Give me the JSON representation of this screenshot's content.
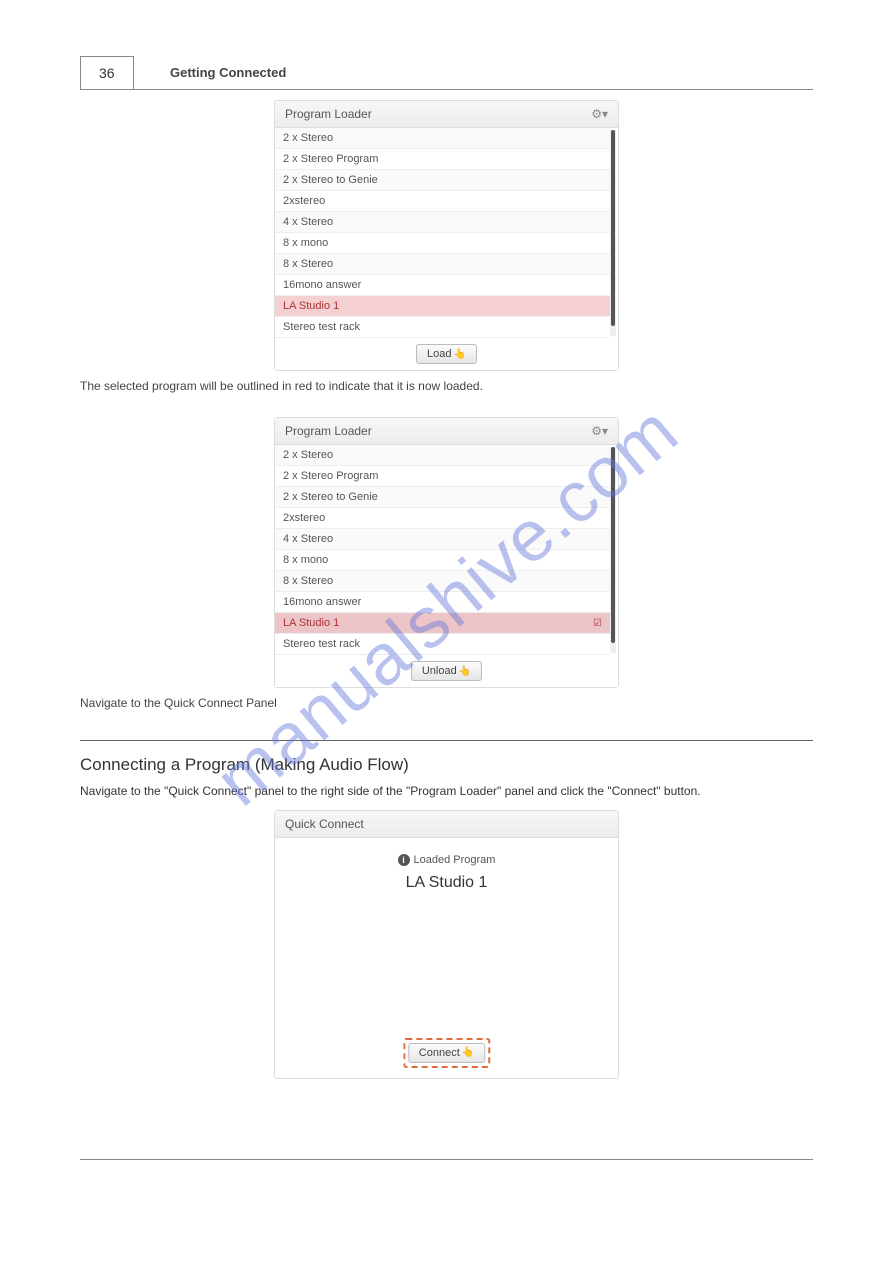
{
  "page": {
    "number": "36",
    "header_title": "Getting Connected",
    "footer_left": "",
    "footer_right": ""
  },
  "watermark": "manualshive.com",
  "panel1": {
    "title": "Program Loader",
    "items": [
      "2 x Stereo",
      "2 x Stereo Program",
      "2 x Stereo to Genie",
      "2xstereo",
      "4 x Stereo",
      "8 x mono",
      "8 x Stereo",
      "16mono answer",
      "LA Studio 1",
      "Stereo test rack"
    ],
    "selected_index": 8,
    "button": "Load"
  },
  "caption1": "The selected program will be outlined in red to indicate that it is now loaded.",
  "panel2": {
    "title": "Program Loader",
    "items": [
      "2 x Stereo",
      "2 x Stereo Program",
      "2 x Stereo to Genie",
      "2xstereo",
      "4 x Stereo",
      "8 x mono",
      "8 x Stereo",
      "16mono answer",
      "LA Studio 1",
      "Stereo test rack"
    ],
    "selected_index": 8,
    "button": "Unload"
  },
  "caption2": "Navigate to the Quick Connect Panel",
  "section": {
    "heading": "Connecting a Program (Making Audio Flow)",
    "body": "Navigate to the \"Quick Connect\" panel to the right side of the \"Program Loader\" panel and click the \"Connect\" button."
  },
  "quick": {
    "title": "Quick Connect",
    "loaded_label": "Loaded Program",
    "program": "LA Studio 1",
    "button": "Connect"
  }
}
